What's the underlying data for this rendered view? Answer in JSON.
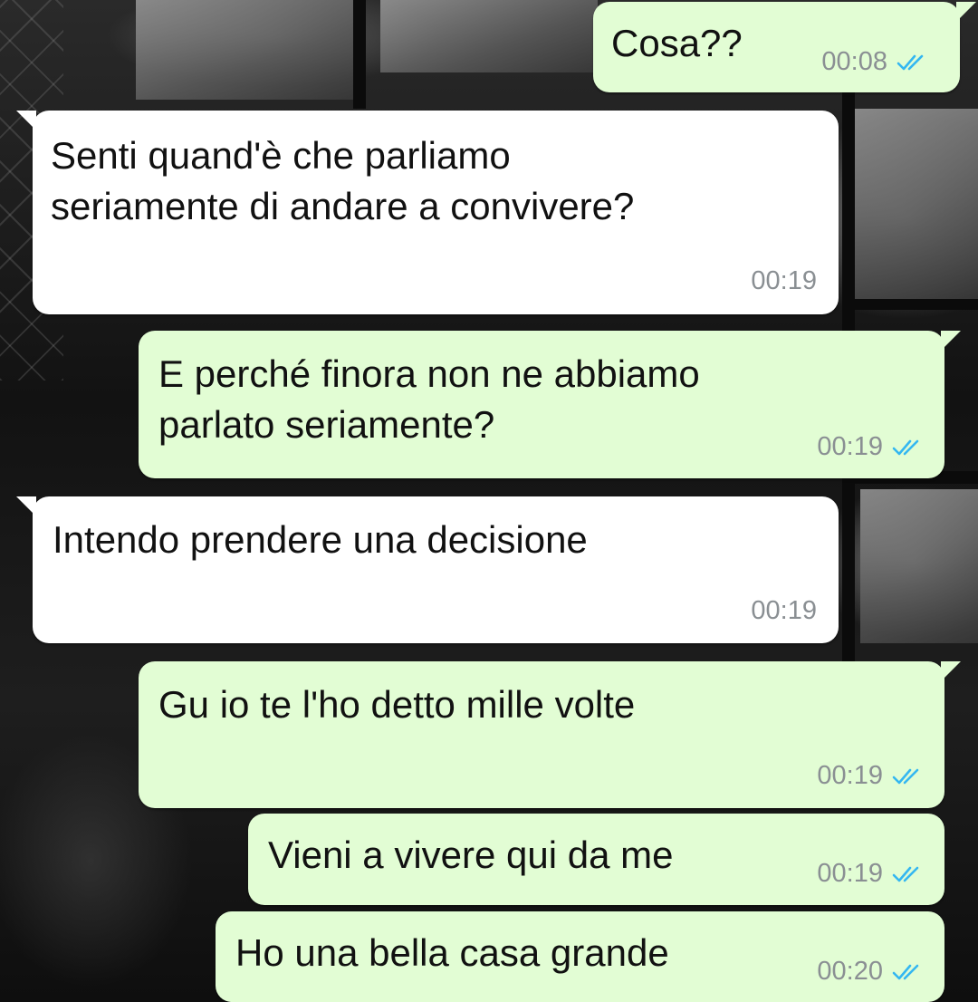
{
  "colors": {
    "outgoing_bubble": "#e2fdd4",
    "incoming_bubble": "#ffffff",
    "read_ticks": "#34b7f1",
    "timestamp": "#8a8f93"
  },
  "messages": [
    {
      "direction": "out",
      "text": "Cosa??",
      "time": "00:08",
      "status": "read",
      "icon": "double-check-icon"
    },
    {
      "direction": "in",
      "text": "Senti quand'è che parliamo\nseriamente di andare a convivere?",
      "time": "00:19"
    },
    {
      "direction": "out",
      "text": "E perché finora non ne abbiamo\nparlato seriamente?",
      "time": "00:19",
      "status": "read",
      "icon": "double-check-icon"
    },
    {
      "direction": "in",
      "text": "Intendo prendere una decisione",
      "time": "00:19"
    },
    {
      "direction": "out",
      "text": "Gu io te l'ho detto mille volte",
      "time": "00:19",
      "status": "read",
      "icon": "double-check-icon"
    },
    {
      "direction": "out",
      "text": "Vieni a vivere qui da me",
      "time": "00:19",
      "status": "read",
      "icon": "double-check-icon"
    },
    {
      "direction": "out",
      "text": "Ho una bella casa grande",
      "time": "00:20",
      "status": "read",
      "icon": "double-check-icon"
    }
  ]
}
